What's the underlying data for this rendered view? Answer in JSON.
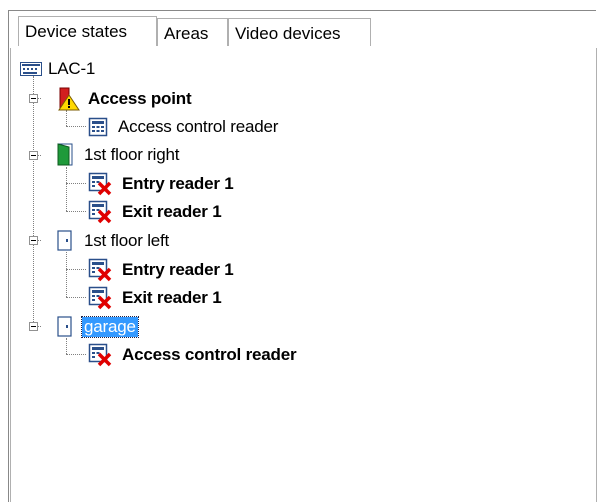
{
  "tabs": [
    "Device states",
    "Areas",
    "Video devices"
  ],
  "tree": {
    "root": {
      "label": "LAC-1",
      "icon": "controller-icon"
    },
    "groups": [
      {
        "label": "Access point",
        "bold": true,
        "icon": "door-warning-icon",
        "children": [
          {
            "label": "Access control reader",
            "bold": false,
            "icon": "reader-icon"
          }
        ]
      },
      {
        "label": "1st floor right",
        "bold": false,
        "icon": "door-open-icon",
        "children": [
          {
            "label": "Entry reader 1",
            "bold": true,
            "icon": "reader-error-icon"
          },
          {
            "label": "Exit reader 1",
            "bold": true,
            "icon": "reader-error-icon"
          }
        ]
      },
      {
        "label": "1st floor left",
        "bold": false,
        "icon": "door-closed-icon",
        "children": [
          {
            "label": "Entry reader 1",
            "bold": true,
            "icon": "reader-error-icon"
          },
          {
            "label": "Exit reader 1",
            "bold": true,
            "icon": "reader-error-icon"
          }
        ]
      },
      {
        "label": "garage",
        "bold": false,
        "selected": true,
        "icon": "door-closed-icon",
        "children": [
          {
            "label": "Access control reader",
            "bold": true,
            "icon": "reader-error-icon"
          }
        ]
      }
    ]
  },
  "colors": {
    "selection": "#3399ff",
    "error": "#e00000",
    "door_green": "#1f9a3a",
    "warning": "#ffcc00"
  }
}
